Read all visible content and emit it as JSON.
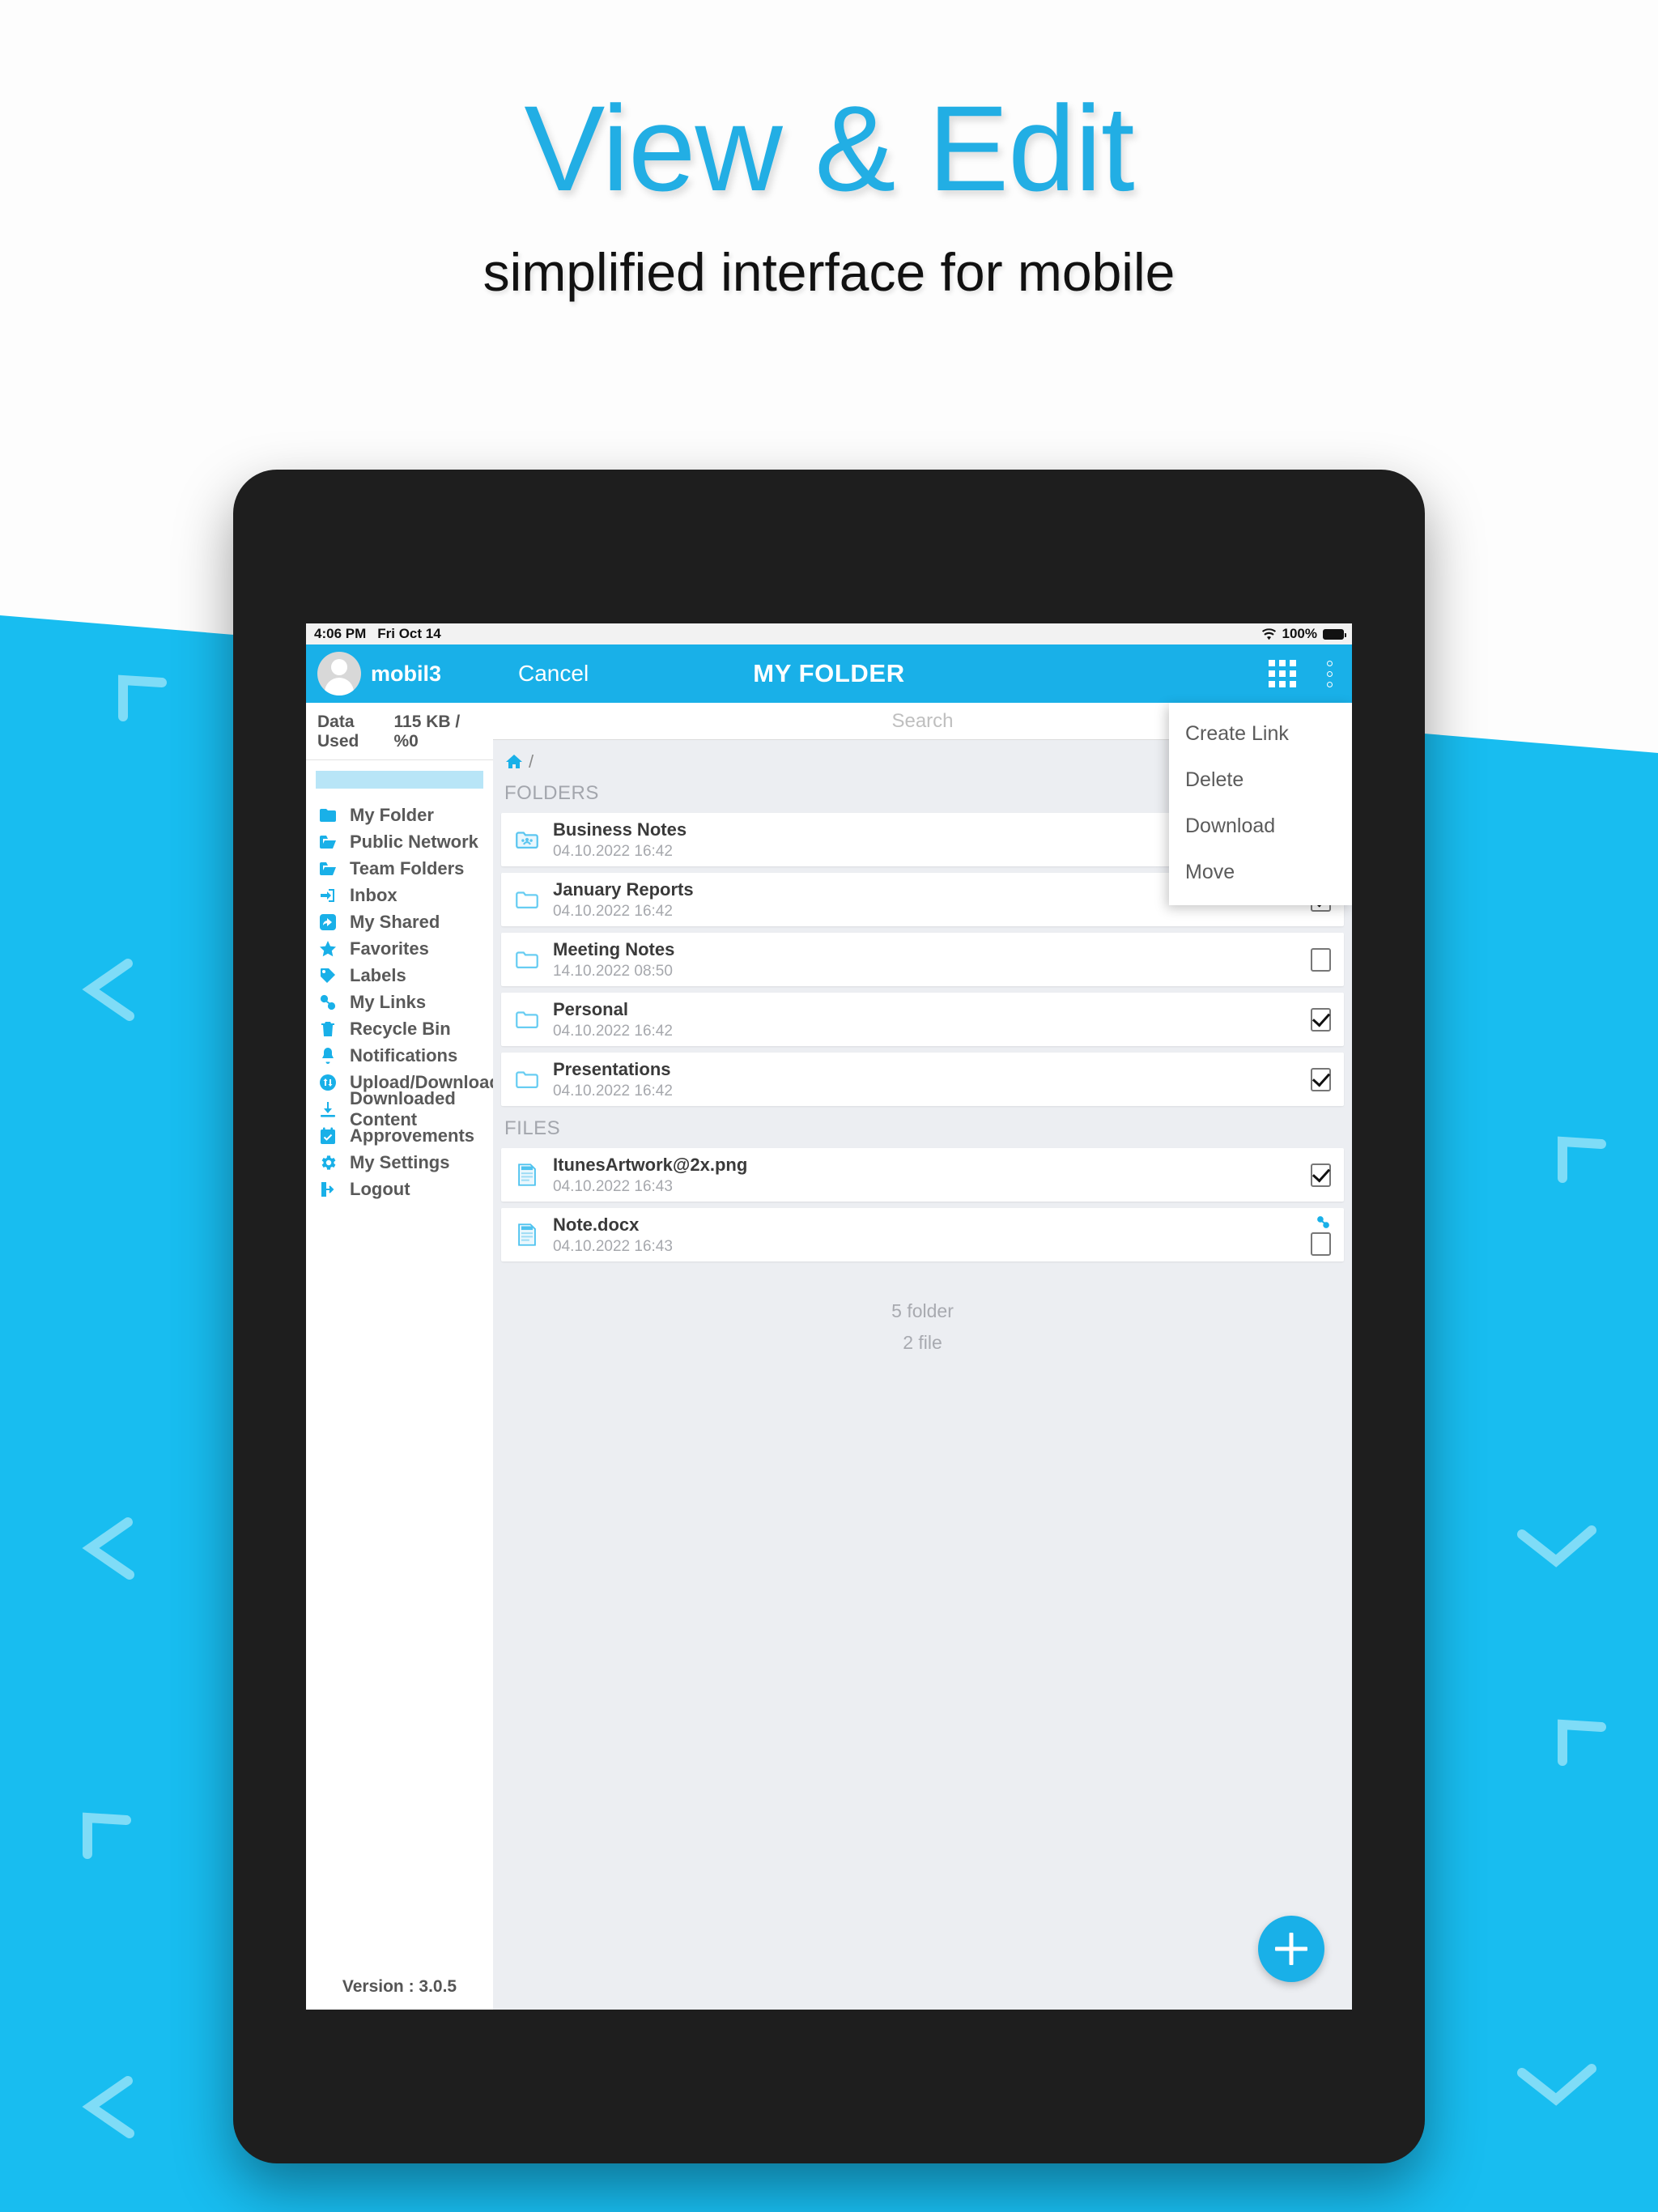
{
  "promo": {
    "title": "View & Edit",
    "subtitle": "simplified interface for mobile",
    "title_color": "#22aee4",
    "accent_color": "#19b0e8"
  },
  "statusbar": {
    "time": "4:06 PM",
    "date": "Fri Oct 14",
    "battery_percent": "100%",
    "wifi_icon": "wifi-icon",
    "battery_icon": "battery-icon"
  },
  "navbar": {
    "username": "mobil3",
    "cancel_label": "Cancel",
    "title": "MY FOLDER",
    "grid_icon": "grid-view-icon",
    "overflow_icon": "overflow-menu-icon",
    "avatar_icon": "avatar"
  },
  "sidebar": {
    "data_used_label": "Data Used",
    "data_used_value": "115 KB / %0",
    "version": "Version : 3.0.5",
    "items": [
      {
        "label": "My Folder",
        "icon": "folder-icon"
      },
      {
        "label": "Public Network",
        "icon": "folder-open-icon"
      },
      {
        "label": "Team Folders",
        "icon": "folder-open-icon"
      },
      {
        "label": "Inbox",
        "icon": "inbox-icon"
      },
      {
        "label": "My Shared",
        "icon": "share-icon"
      },
      {
        "label": "Favorites",
        "icon": "star-icon"
      },
      {
        "label": "Labels",
        "icon": "tag-icon"
      },
      {
        "label": "My Links",
        "icon": "link-icon"
      },
      {
        "label": "Recycle Bin",
        "icon": "trash-icon"
      },
      {
        "label": "Notifications",
        "icon": "bell-icon"
      },
      {
        "label": "Upload/Download",
        "icon": "transfer-icon"
      },
      {
        "label": "Downloaded Content",
        "icon": "download-icon"
      },
      {
        "label": "Approvements",
        "icon": "calendar-check-icon"
      },
      {
        "label": "My Settings",
        "icon": "gear-icon"
      },
      {
        "label": "Logout",
        "icon": "logout-icon"
      }
    ]
  },
  "main": {
    "search_placeholder": "Search",
    "breadcrumb_root_icon": "home-icon",
    "breadcrumb_separator": "/",
    "folders_header": "FOLDERS",
    "files_header": "FILES",
    "folders": [
      {
        "name": "Business Notes",
        "date": "04.10.2022 16:42",
        "icon": "shared-folder-icon",
        "checked": false,
        "has_checkbox": false,
        "linked": false
      },
      {
        "name": "January Reports",
        "date": "04.10.2022 16:42",
        "icon": "folder-icon",
        "checked": true,
        "has_checkbox": true,
        "linked": false
      },
      {
        "name": "Meeting Notes",
        "date": "14.10.2022 08:50",
        "icon": "folder-icon",
        "checked": false,
        "has_checkbox": true,
        "linked": false
      },
      {
        "name": "Personal",
        "date": "04.10.2022 16:42",
        "icon": "folder-icon",
        "checked": true,
        "has_checkbox": true,
        "linked": false
      },
      {
        "name": "Presentations",
        "date": "04.10.2022 16:42",
        "icon": "folder-icon",
        "checked": true,
        "has_checkbox": true,
        "linked": false
      }
    ],
    "files": [
      {
        "name": "ItunesArtwork@2x.png",
        "date": "04.10.2022 16:43",
        "icon": "image-file-icon",
        "checked": true,
        "has_checkbox": true,
        "linked": false
      },
      {
        "name": "Note.docx",
        "date": "04.10.2022 16:43",
        "icon": "doc-file-icon",
        "checked": false,
        "has_checkbox": true,
        "linked": true
      }
    ],
    "folder_count": "5 folder",
    "file_count": "2 file",
    "fab_icon": "add-icon"
  },
  "context_menu": {
    "items": [
      "Create Link",
      "Delete",
      "Download",
      "Move"
    ]
  }
}
